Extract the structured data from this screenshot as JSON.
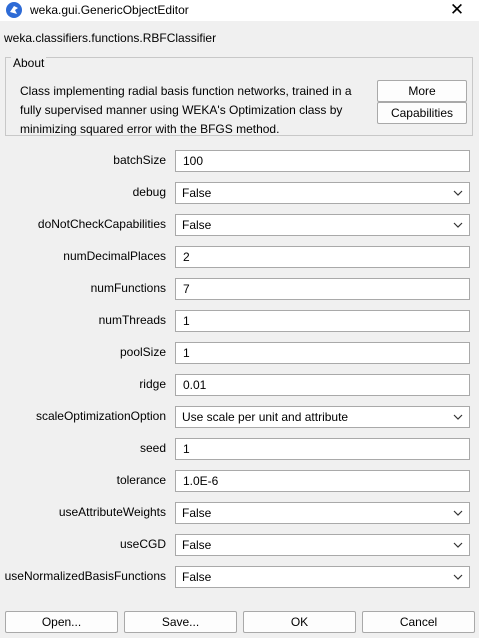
{
  "window": {
    "title": "weka.gui.GenericObjectEditor",
    "close": "✕"
  },
  "classname": "weka.classifiers.functions.RBFClassifier",
  "about": {
    "legend": "About",
    "text": "Class implementing radial basis function networks, trained in a fully supervised manner using WEKA's Optimization class by minimizing squared error with the BFGS method.",
    "more_label": "More",
    "capabilities_label": "Capabilities"
  },
  "properties": [
    {
      "label": "batchSize",
      "value": "100",
      "kind": "text"
    },
    {
      "label": "debug",
      "value": "False",
      "kind": "combo"
    },
    {
      "label": "doNotCheckCapabilities",
      "value": "False",
      "kind": "combo"
    },
    {
      "label": "numDecimalPlaces",
      "value": "2",
      "kind": "text"
    },
    {
      "label": "numFunctions",
      "value": "7",
      "kind": "text"
    },
    {
      "label": "numThreads",
      "value": "1",
      "kind": "text"
    },
    {
      "label": "poolSize",
      "value": "1",
      "kind": "text"
    },
    {
      "label": "ridge",
      "value": "0.01",
      "kind": "text"
    },
    {
      "label": "scaleOptimizationOption",
      "value": "Use scale per unit and attribute",
      "kind": "combo"
    },
    {
      "label": "seed",
      "value": "1",
      "kind": "text"
    },
    {
      "label": "tolerance",
      "value": "1.0E-6",
      "kind": "text"
    },
    {
      "label": "useAttributeWeights",
      "value": "False",
      "kind": "combo"
    },
    {
      "label": "useCGD",
      "value": "False",
      "kind": "combo"
    },
    {
      "label": "useNormalizedBasisFunctions",
      "value": "False",
      "kind": "combo"
    }
  ],
  "buttons": {
    "open": "Open...",
    "save": "Save...",
    "ok": "OK",
    "cancel": "Cancel"
  },
  "colors": {
    "accent": "#2e6bd6",
    "border": "#a9a9a9",
    "background": "#f0f0f0"
  }
}
